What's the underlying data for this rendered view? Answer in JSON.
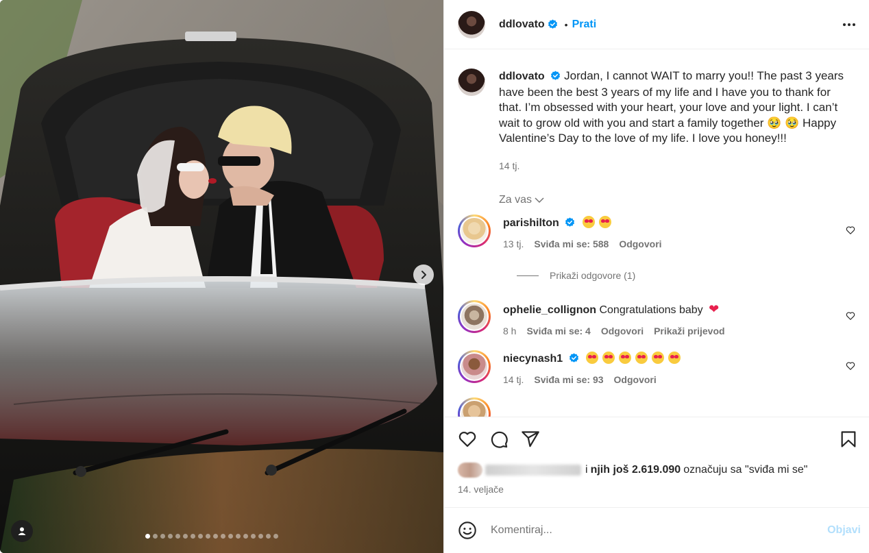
{
  "post": {
    "carousel_dots": 18,
    "active_dot": 0
  },
  "author": {
    "username": "ddlovato",
    "follow_label": "Prati",
    "separator": "•"
  },
  "caption": {
    "text": "Jordan, I cannot WAIT to marry you!! The past 3 years have been the best 3 years of my life and I have you to thank for that. I’m obsessed with your heart, your love and your light. I can’t wait to grow old with you and start a family together 🥹 🥹 Happy Valentine’s Day to the love of my life. I love you honey!!!",
    "time": "14 tj."
  },
  "filter_label": "Za vas",
  "comments": [
    {
      "user": "parishilton",
      "verified": true,
      "text": "",
      "emojis": 2,
      "time": "13 tj.",
      "likes": "Sviđa mi se: 588",
      "reply": "Odgovori",
      "translate": ""
    },
    {
      "user": "ophelie_collignon",
      "verified": false,
      "text": "Congratulations baby",
      "time": "8 h",
      "likes": "Sviđa mi se: 4",
      "reply": "Odgovori",
      "translate": "Prikaži prijevod"
    },
    {
      "user": "niecynash1",
      "verified": true,
      "text": "",
      "emojis": 6,
      "time": "14 tj.",
      "likes": "Sviđa mi se: 93",
      "reply": "Odgovori",
      "translate": ""
    }
  ],
  "show_replies": "Prikaži odgovore (1)",
  "likes_line": {
    "prefix": "i",
    "bold": "njih još 2.619.090",
    "suffix": "označuju sa \"sviđa mi se\""
  },
  "post_date": "14. veljače",
  "composer": {
    "placeholder": "Komentiraj...",
    "post_label": "Objavi"
  },
  "colors": {
    "link_blue": "#0095f6",
    "verified_blue": "#0095f6",
    "muted": "#737373",
    "disabled_blue": "#b2dffc"
  }
}
